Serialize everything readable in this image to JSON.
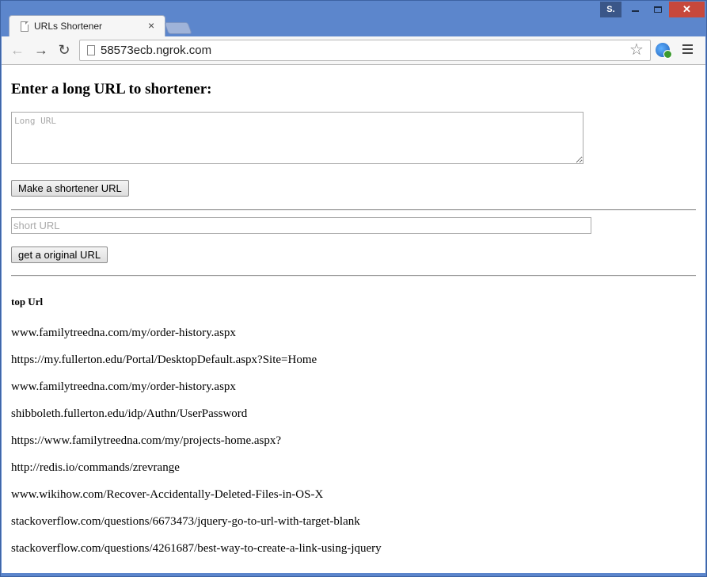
{
  "window": {
    "user_badge": "S.",
    "minimize_label": "",
    "close_label": "✕"
  },
  "tab": {
    "title": "URLs Shortener",
    "close_glyph": "×"
  },
  "toolbar": {
    "back_glyph": "←",
    "forward_glyph": "→",
    "reload_glyph": "↻",
    "address": "58573ecb.ngrok.com",
    "star_glyph": "☆"
  },
  "page": {
    "heading": "Enter a long URL to shortener:",
    "long_url_placeholder": "Long URL",
    "make_button": "Make a shortener URL",
    "short_url_placeholder": "short URL",
    "get_button": "get a original URL",
    "top_title": "top Url",
    "top_urls": [
      "www.familytreedna.com/my/order-history.aspx",
      "https://my.fullerton.edu/Portal/DesktopDefault.aspx?Site=Home",
      "www.familytreedna.com/my/order-history.aspx",
      "shibboleth.fullerton.edu/idp/Authn/UserPassword",
      "https://www.familytreedna.com/my/projects-home.aspx?",
      "http://redis.io/commands/zrevrange",
      "www.wikihow.com/Recover-Accidentally-Deleted-Files-in-OS-X",
      "stackoverflow.com/questions/6673473/jquery-go-to-url-with-target-blank",
      "stackoverflow.com/questions/4261687/best-way-to-create-a-link-using-jquery"
    ]
  },
  "colors": {
    "frame": "#5c86cc",
    "close_button": "#c7483c",
    "user_badge": "#3a5688"
  },
  "icons": [
    "page-icon",
    "star-icon",
    "extension-globe-icon",
    "menu-icon",
    "back-arrow-icon",
    "forward-arrow-icon",
    "reload-icon",
    "close-icon",
    "minimize-icon",
    "maximize-icon"
  ]
}
